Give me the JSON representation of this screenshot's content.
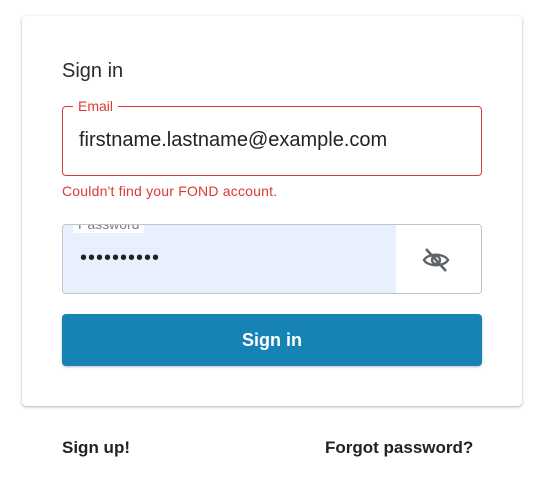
{
  "card": {
    "heading": "Sign in",
    "email": {
      "label": "Email",
      "value": "firstname.lastname@example.com",
      "error": "Couldn't find your FOND account."
    },
    "password": {
      "label": "Password",
      "value": "••••••••••",
      "toggle_icon": "eye-off-icon"
    },
    "submit_label": "Sign in"
  },
  "footer": {
    "signup_label": "Sign up!",
    "forgot_label": "Forgot password?"
  },
  "colors": {
    "primary": "#1583b3",
    "error": "#d93a32",
    "autofill": "#e8effd"
  }
}
